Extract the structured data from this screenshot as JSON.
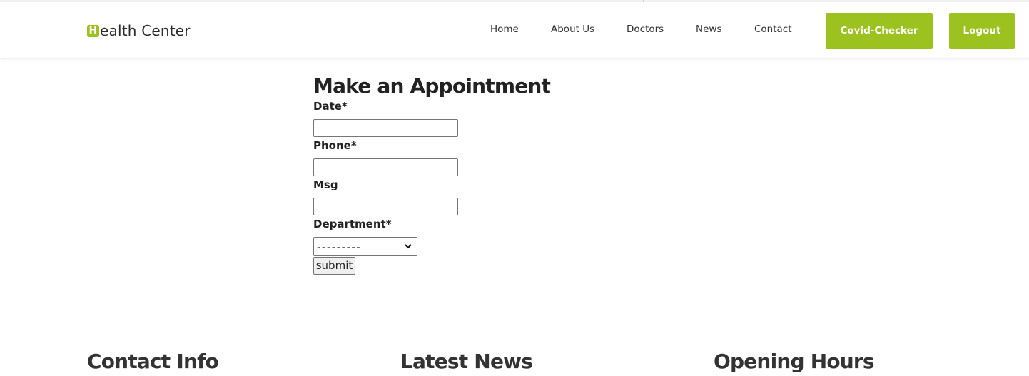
{
  "header": {
    "logo_mark": "H",
    "logo_text": "ealth Center",
    "nav": [
      {
        "label": "Home"
      },
      {
        "label": "About Us"
      },
      {
        "label": "Doctors"
      },
      {
        "label": "News"
      },
      {
        "label": "Contact"
      }
    ],
    "covid_button": "Covid-Checker",
    "logout_button": "Logout"
  },
  "colors": {
    "accent": "#9cc21f",
    "text": "#222222"
  },
  "form": {
    "title": "Make an Appointment",
    "fields": [
      {
        "label": "Date*",
        "value": ""
      },
      {
        "label": "Phone*",
        "value": ""
      },
      {
        "label": "Msg",
        "value": ""
      }
    ],
    "department": {
      "label": "Department*",
      "selected": "---------"
    },
    "submit_label": "submit"
  },
  "footer": {
    "headings": [
      "Contact Info",
      "Latest News",
      "Opening Hours"
    ]
  }
}
